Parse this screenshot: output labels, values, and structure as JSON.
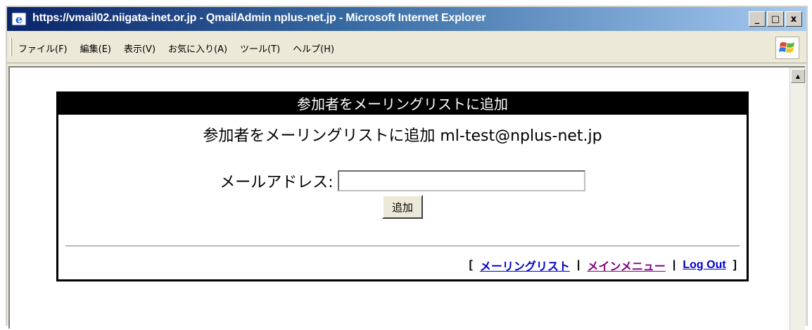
{
  "window": {
    "title": "https://vmail02.niigata-inet.or.jp - QmailAdmin nplus-net.jp - Microsoft Internet Explorer",
    "buttons": {
      "minimize": "_",
      "maximize": "□",
      "close": "x"
    }
  },
  "menubar": {
    "items": [
      {
        "label": "ファイル(F)"
      },
      {
        "label": "編集(E)"
      },
      {
        "label": "表示(V)"
      },
      {
        "label": "お気に入り(A)"
      },
      {
        "label": "ツール(T)"
      },
      {
        "label": "ヘルプ(H)"
      }
    ]
  },
  "panel": {
    "header": "参加者をメーリングリストに追加",
    "title": "参加者をメーリングリストに追加 ml-test@nplus-net.jp",
    "email_label": "メールアドレス:",
    "email_value": "",
    "add_button": "追加"
  },
  "footer": {
    "open_bracket": "[",
    "close_bracket": "]",
    "separator": "|",
    "links": {
      "mailing_list": "メーリングリスト",
      "main_menu": "メインメニュー",
      "logout": "Log Out"
    }
  },
  "colors": {
    "link": "#0000cc",
    "link_visited": "#800080",
    "panel_header_bg": "#000000"
  }
}
